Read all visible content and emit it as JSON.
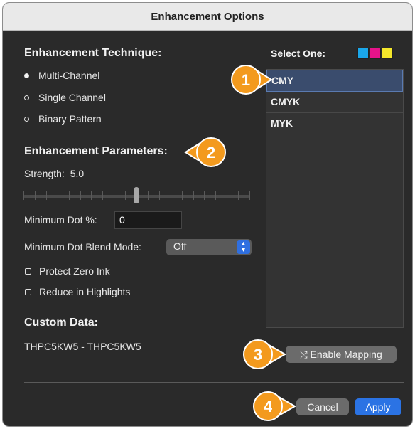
{
  "window": {
    "title": "Enhancement Options"
  },
  "technique": {
    "title": "Enhancement Technique:",
    "options": [
      "Multi-Channel",
      "Single Channel",
      "Binary Pattern"
    ],
    "selected": "Multi-Channel"
  },
  "select_one": {
    "label": "Select One:",
    "items": [
      "CMY",
      "CMYK",
      "MYK"
    ],
    "selected": "CMY",
    "swatch_colors": [
      "#1aa7ea",
      "#e6138a",
      "#f4e72b"
    ]
  },
  "parameters": {
    "title": "Enhancement Parameters:",
    "strength_label": "Strength:",
    "strength_value": "5.0",
    "strength_fraction": 0.5,
    "min_dot_label": "Minimum Dot %:",
    "min_dot_value": "0",
    "blend_label": "Minimum Dot Blend Mode:",
    "blend_value": "Off",
    "protect_zero_ink": "Protect Zero Ink",
    "reduce_highlights": "Reduce in Highlights"
  },
  "custom_data": {
    "title": "Custom Data:",
    "value": "THPC5KW5 - THPC5KW5"
  },
  "buttons": {
    "enable_mapping": "Enable Mapping",
    "cancel": "Cancel",
    "apply": "Apply"
  },
  "callouts": [
    "1",
    "2",
    "3",
    "4"
  ],
  "colors": {
    "accent": "#2b73e4",
    "callout": "#f39a1e",
    "selected_row": "#3a4c6d"
  }
}
